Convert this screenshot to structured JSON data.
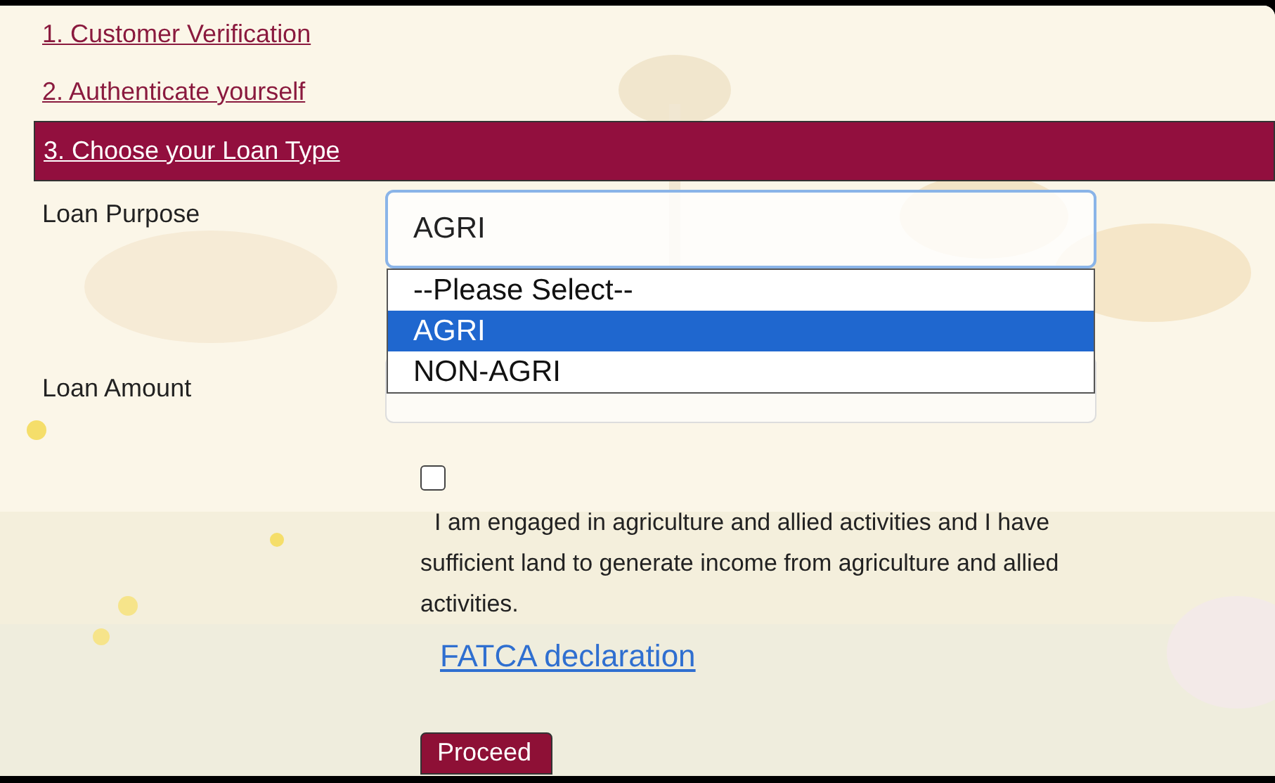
{
  "steps": [
    {
      "label": "1. Customer Verification",
      "selected": false
    },
    {
      "label": "2. Authenticate yourself",
      "selected": false
    },
    {
      "label": "3. Choose your Loan Type",
      "selected": true
    }
  ],
  "loan_purpose": {
    "label": "Loan Purpose",
    "value": "AGRI",
    "expanded": true,
    "options": [
      {
        "label": "--Please Select--",
        "selected": false
      },
      {
        "label": "AGRI",
        "selected": true
      },
      {
        "label": "NON-AGRI",
        "selected": false
      }
    ]
  },
  "loan_amount": {
    "label": "Loan Amount"
  },
  "declaration": {
    "checked": false,
    "text": "I am engaged in agriculture and allied activities and I have sufficient land to generate income from agriculture and allied activities."
  },
  "link": "FATCA declaration",
  "button": "Proceed"
}
